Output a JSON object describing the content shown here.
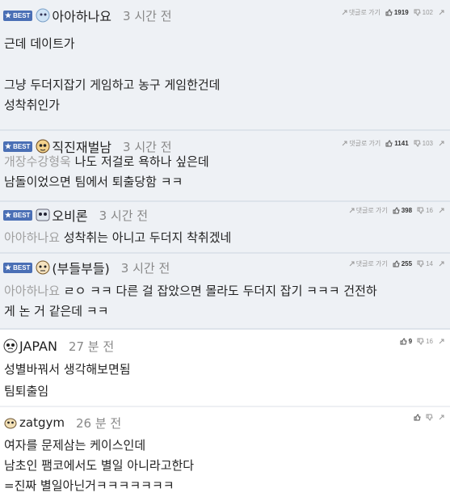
{
  "comments": [
    {
      "best": true,
      "badge": "BEST",
      "nick": "아아하나요",
      "time": "3 시간 전",
      "reply_label": "댓글로 가기",
      "likes": "1919",
      "dislikes": "102",
      "lines": [
        "근데 데이트가",
        "",
        "그냥 두더지잡기 게임하고 농구 게임한건데",
        "성착취인가"
      ]
    },
    {
      "best": true,
      "badge": "BEST",
      "nick": "직진재벌남",
      "time": "3 시간 전",
      "reply_label": "댓글로 가기",
      "likes": "1141",
      "dislikes": "103",
      "reply_to": "개장수강형욱",
      "lines": [
        "나도 저걸로 욕하나 싶은데",
        "남돌이었으면 팀에서 퇴출당함 ㅋㅋ"
      ]
    },
    {
      "best": true,
      "badge": "BEST",
      "nick": "오비론",
      "time": "3 시간 전",
      "reply_label": "댓글로 가기",
      "likes": "398",
      "dislikes": "16",
      "reply_to": "아아하나요",
      "lines": [
        "성착취는 아니고 두더지 착취겠네"
      ]
    },
    {
      "best": true,
      "badge": "BEST",
      "nick": "(부들부들)",
      "time": "3 시간 전",
      "reply_label": "댓글로 가기",
      "likes": "255",
      "dislikes": "14",
      "reply_to": "아아하나요",
      "lines": [
        "ㄹㅇ ㅋㅋ 다른 걸 잡았으면 몰라도 두더지 잡기 ㅋㅋㅋ 건전하",
        "게 논 거 같은데 ㅋㅋ"
      ]
    },
    {
      "best": false,
      "nick": "JAPAN",
      "time": "27 분 전",
      "likes": "9",
      "dislikes": "16",
      "lines": [
        "성별바꿔서 생각해보면됨",
        "팀퇴출임"
      ]
    },
    {
      "best": false,
      "nick": "zatgym",
      "time": "26 분 전",
      "likes": "",
      "dislikes": "",
      "lines": [
        "여자를 문제삼는 케이스인데",
        "남초인 팸코에서도 별일 아니라고한다",
        "=진짜 별일아닌거ㅋㅋㅋㅋㅋㅋㅋ"
      ]
    }
  ],
  "colors": {
    "best_bg": "#eef1f5",
    "badge_bg": "#4a6fb5",
    "separator": "#dde3ea"
  },
  "icons": {
    "reply": "reply-arrow-icon",
    "like": "thumbs-up-icon",
    "dislike": "thumbs-down-icon",
    "link": "link-icon"
  }
}
